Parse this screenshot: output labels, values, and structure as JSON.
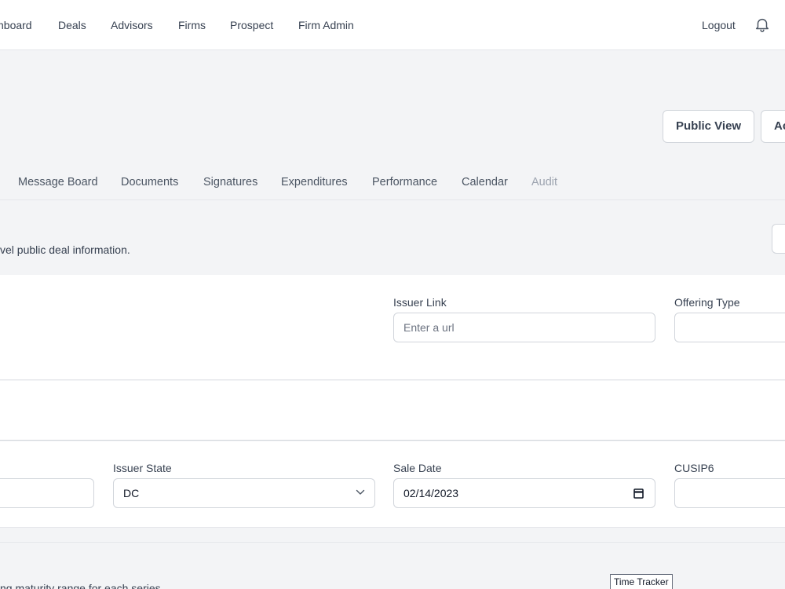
{
  "nav": {
    "items": [
      "nboard",
      "Deals",
      "Advisors",
      "Firms",
      "Prospect",
      "Firm Admin"
    ],
    "logout": "Logout"
  },
  "header": {
    "public_view": "Public View",
    "second_button": "Ac"
  },
  "tabs": [
    "Message Board",
    "Documents",
    "Signatures",
    "Expenditures",
    "Performance",
    "Calendar",
    "Audit"
  ],
  "info_text": "vel public deal information.",
  "section1": {
    "issuer_link_label": "Issuer Link",
    "issuer_link_placeholder": "Enter a url",
    "offering_type_label": "Offering Type"
  },
  "section3": {
    "issuer_state_label": "Issuer State",
    "issuer_state_value": "DC",
    "sale_date_label": "Sale Date",
    "sale_date_value": "02/14/2023",
    "cusip6_label": "CUSIP6"
  },
  "bottom_text": "ng maturity range for each series.",
  "tooltip": "Time Tracker",
  "colors": {
    "border": "#d1d5db",
    "background": "#f3f4f6",
    "text": "#374151"
  }
}
